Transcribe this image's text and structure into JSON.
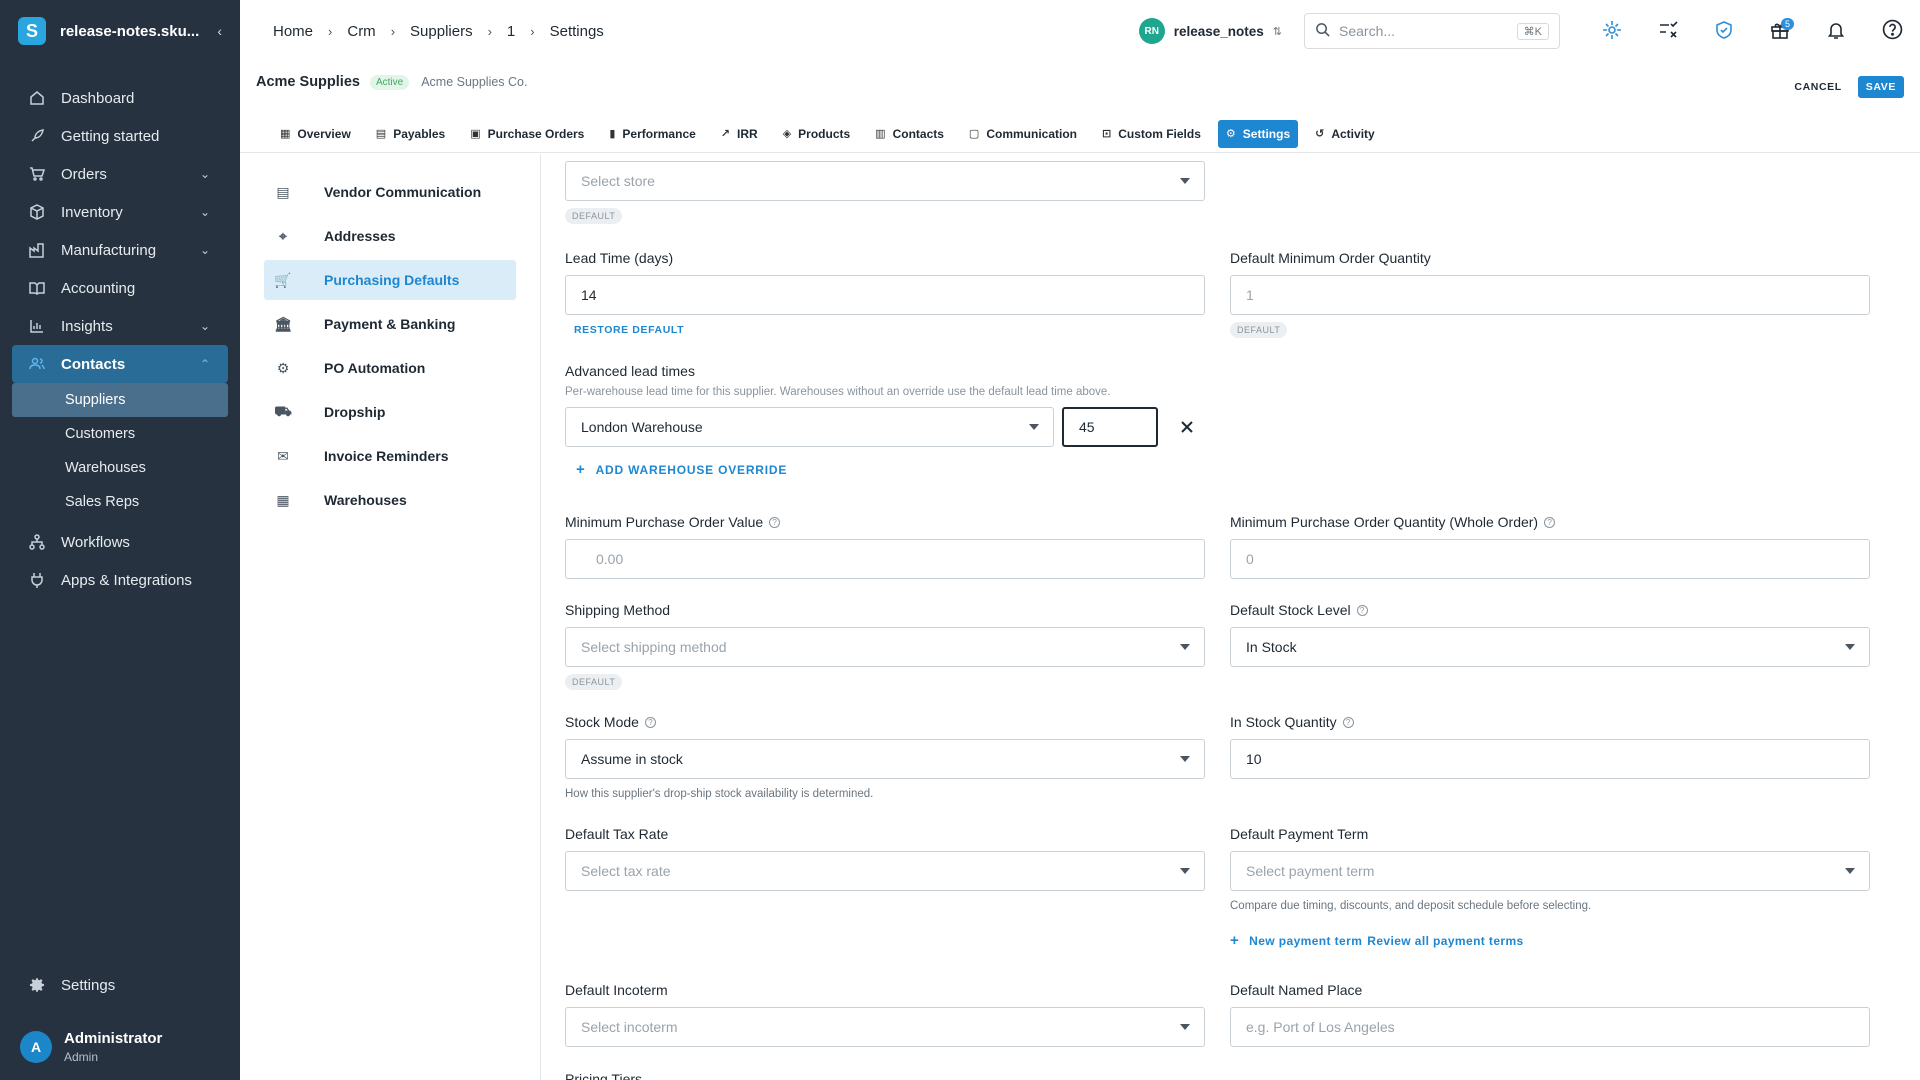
{
  "app": {
    "title": "release-notes.sku...",
    "logo_letter": "S"
  },
  "sidebar": {
    "items": [
      {
        "label": "Dashboard",
        "icon": "home-icon",
        "chevron": false
      },
      {
        "label": "Getting started",
        "icon": "rocket-icon",
        "chevron": false
      },
      {
        "label": "Orders",
        "icon": "cart-icon",
        "chevron": true
      },
      {
        "label": "Inventory",
        "icon": "box-icon",
        "chevron": true
      },
      {
        "label": "Manufacturing",
        "icon": "factory-icon",
        "chevron": true
      },
      {
        "label": "Accounting",
        "icon": "book-icon",
        "chevron": false
      },
      {
        "label": "Insights",
        "icon": "chart-icon",
        "chevron": true
      }
    ],
    "contacts": {
      "label": "Contacts",
      "children": [
        "Suppliers",
        "Customers",
        "Warehouses",
        "Sales Reps"
      ],
      "selected": "Suppliers"
    },
    "bottom_items": [
      {
        "label": "Workflows",
        "icon": "workflow-icon"
      },
      {
        "label": "Apps & Integrations",
        "icon": "plug-icon"
      }
    ],
    "settings_label": "Settings",
    "user": {
      "initial": "A",
      "name": "Administrator",
      "role": "Admin"
    }
  },
  "breadcrumb": [
    "Home",
    "Crm",
    "Suppliers",
    "1",
    "Settings"
  ],
  "workspace": {
    "initials": "RN",
    "name": "release_notes"
  },
  "search": {
    "placeholder": "Search...",
    "shortcut": "⌘K"
  },
  "notifications": {
    "gift_count": "5"
  },
  "record": {
    "title": "Acme Supplies",
    "status": "Active",
    "company": "Acme Supplies Co."
  },
  "actions": {
    "cancel": "CANCEL",
    "save": "SAVE"
  },
  "tabs": [
    {
      "label": "Overview",
      "icon": "▦"
    },
    {
      "label": "Payables",
      "icon": "▤"
    },
    {
      "label": "Purchase Orders",
      "icon": "▣"
    },
    {
      "label": "Performance",
      "icon": "▮"
    },
    {
      "label": "IRR",
      "icon": "↗"
    },
    {
      "label": "Products",
      "icon": "◈"
    },
    {
      "label": "Contacts",
      "icon": "▥"
    },
    {
      "label": "Communication",
      "icon": "▢"
    },
    {
      "label": "Custom Fields",
      "icon": "⊡"
    },
    {
      "label": "Settings",
      "icon": "⚙",
      "active": true
    },
    {
      "label": "Activity",
      "icon": "↺"
    }
  ],
  "sections": [
    {
      "label": "Vendor Communication",
      "icon": "▤"
    },
    {
      "label": "Addresses",
      "icon": "⌖"
    },
    {
      "label": "Purchasing Defaults",
      "icon": "🛒",
      "active": true
    },
    {
      "label": "Payment & Banking",
      "icon": "🏛"
    },
    {
      "label": "PO Automation",
      "icon": "⚙"
    },
    {
      "label": "Dropship",
      "icon": "⛟"
    },
    {
      "label": "Invoice Reminders",
      "icon": "✉"
    },
    {
      "label": "Warehouses",
      "icon": "▦"
    }
  ],
  "form": {
    "store": {
      "placeholder": "Select store",
      "chip": "DEFAULT"
    },
    "lead_time": {
      "label": "Lead Time (days)",
      "value": "14",
      "restore": "RESTORE DEFAULT"
    },
    "min_qty": {
      "label": "Default Minimum Order Quantity",
      "placeholder": "1",
      "chip": "DEFAULT"
    },
    "advanced": {
      "label": "Advanced lead times",
      "hint": "Per-warehouse lead time for this supplier. Warehouses without an override use the default lead time above.",
      "warehouse": "London Warehouse",
      "days": "45",
      "add": "ADD WAREHOUSE OVERRIDE"
    },
    "min_po_value": {
      "label": "Minimum Purchase Order Value",
      "placeholder": "0.00"
    },
    "min_po_qty": {
      "label": "Minimum Purchase Order Quantity (Whole Order)",
      "placeholder": "0"
    },
    "shipping": {
      "label": "Shipping Method",
      "placeholder": "Select shipping method",
      "chip": "DEFAULT"
    },
    "stock_level": {
      "label": "Default Stock Level",
      "value": "In Stock"
    },
    "stock_mode": {
      "label": "Stock Mode",
      "value": "Assume in stock",
      "hint": "How this supplier's drop-ship stock availability is determined."
    },
    "in_stock_qty": {
      "label": "In Stock Quantity",
      "value": "10"
    },
    "tax_rate": {
      "label": "Default Tax Rate",
      "placeholder": "Select tax rate"
    },
    "payment_term": {
      "label": "Default Payment Term",
      "placeholder": "Select payment term",
      "hint": "Compare due timing, discounts, and deposit schedule before selecting.",
      "new_link": "New payment term",
      "review_link": "Review all payment terms"
    },
    "incoterm": {
      "label": "Default Incoterm",
      "placeholder": "Select incoterm"
    },
    "named_place": {
      "label": "Default Named Place",
      "placeholder": "e.g. Port of Los Angeles"
    },
    "pricing_tiers": {
      "label": "Pricing Tiers"
    }
  },
  "colors": {
    "sidebar_bg": "#26323f",
    "accent": "#1d87d1",
    "active_nav": "#2a6c98"
  }
}
